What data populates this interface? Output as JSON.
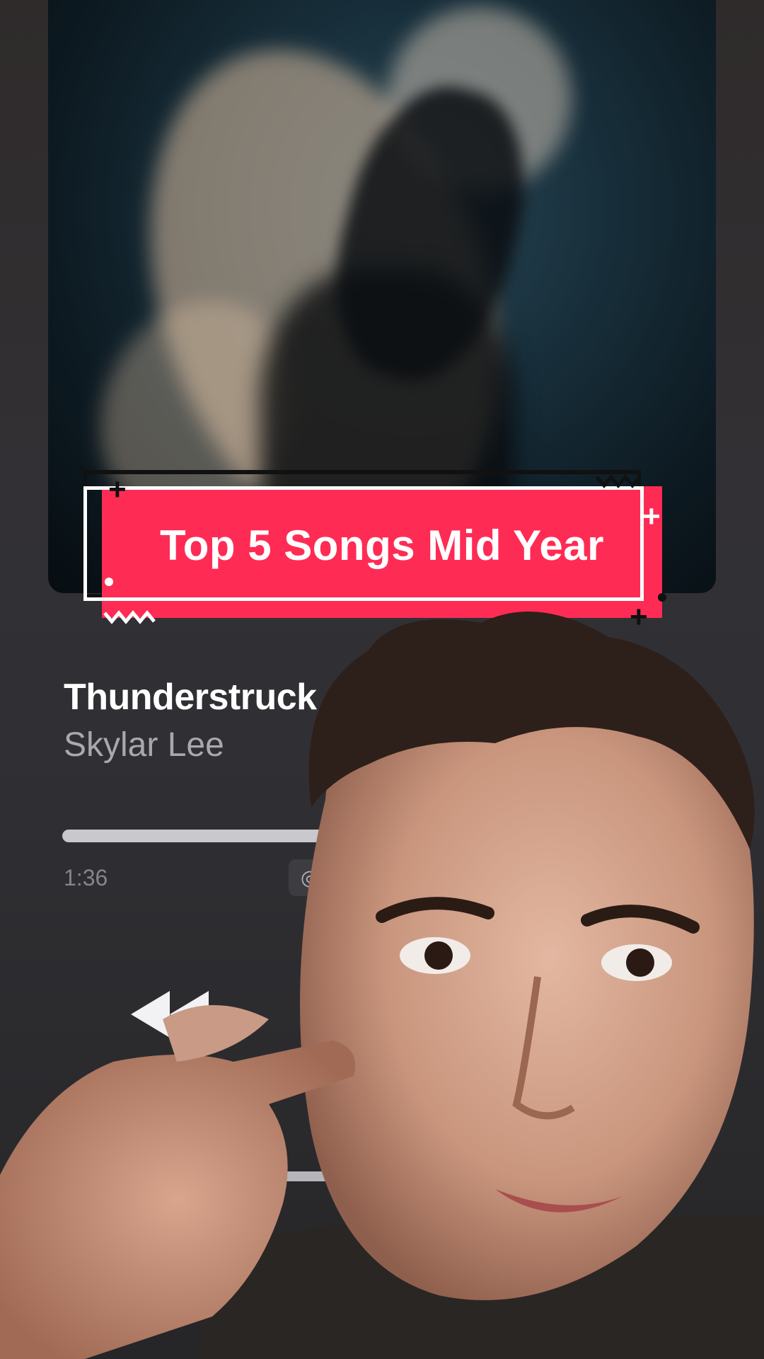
{
  "banner": {
    "text": "Top 5 Songs Mid Year"
  },
  "song": {
    "title": "Thunderstruck",
    "artist": "Skylar Lee",
    "elapsed": "1:36",
    "progress": 0.43
  },
  "icons": {
    "badge": "lossless-icon",
    "rewind": "rewind-icon",
    "airplay": "airplay-icon"
  },
  "colors": {
    "banner": "#fe2c55",
    "background": "#2b2a2e",
    "title": "#ffffff",
    "artist": "#a9a8ad"
  }
}
